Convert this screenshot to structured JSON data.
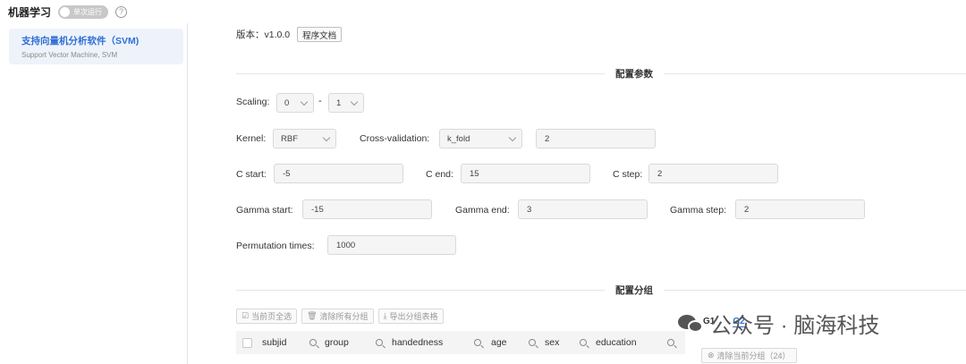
{
  "header": {
    "title": "机器学习",
    "toggle_label": "单次运行",
    "help_icon": "?"
  },
  "sidebar": {
    "items": [
      {
        "name": "支持向量机分析软件（SVM)",
        "sub": "Support Vector Machine, SVM"
      }
    ]
  },
  "version": {
    "text": "版本：v1.0.0",
    "doc_button": "程序文档"
  },
  "sections": {
    "config_params": "配置参数",
    "config_groups": "配置分组"
  },
  "params": {
    "scaling_label": "Scaling:",
    "scaling_min": "0",
    "scaling_sep": "-",
    "scaling_max": "1",
    "kernel_label": "Kernel:",
    "kernel_value": "RBF",
    "cv_label": "Cross-validation:",
    "cv_value": "k_fold",
    "cv_folds": "2",
    "c_start_label": "C start:",
    "c_start": "-5",
    "c_end_label": "C end:",
    "c_end": "15",
    "c_step_label": "C step:",
    "c_step": "2",
    "gamma_start_label": "Gamma start:",
    "gamma_start": "-15",
    "gamma_end_label": "Gamma end:",
    "gamma_end": "3",
    "gamma_step_label": "Gamma step:",
    "gamma_step": "2",
    "perm_label": "Permutation times:",
    "perm_value": "1000"
  },
  "toolbar": {
    "select_page": "当前页全选",
    "clear_all": "清除所有分组",
    "export": "导出分组表格"
  },
  "table": {
    "columns": [
      "subjid",
      "group",
      "handedness",
      "age",
      "sex",
      "education"
    ]
  },
  "groups": {
    "tabs": [
      "G1",
      "G2"
    ],
    "clear_current": "清除当前分组（24）"
  },
  "watermark": {
    "text": "公众号 · 脑海科技"
  }
}
